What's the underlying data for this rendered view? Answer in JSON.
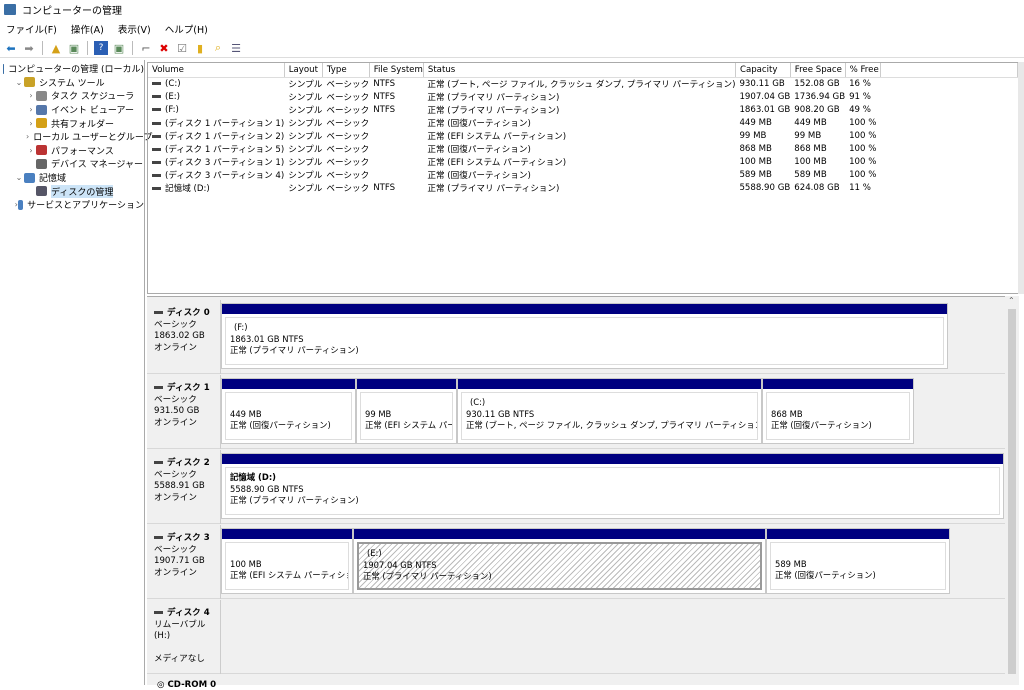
{
  "window": {
    "title": "コンピューターの管理"
  },
  "menu": [
    "ファイル(F)",
    "操作(A)",
    "表示(V)",
    "ヘルプ(H)"
  ],
  "tree": [
    {
      "label": "コンピューターの管理 (ローカル)",
      "level": 0,
      "chev": ""
    },
    {
      "label": "システム ツール",
      "level": 1,
      "chev": "⌄"
    },
    {
      "label": "タスク スケジューラ",
      "level": 2,
      "chev": "›"
    },
    {
      "label": "イベント ビューアー",
      "level": 2,
      "chev": "›"
    },
    {
      "label": "共有フォルダー",
      "level": 2,
      "chev": "›"
    },
    {
      "label": "ローカル ユーザーとグループ",
      "level": 2,
      "chev": "›"
    },
    {
      "label": "パフォーマンス",
      "level": 2,
      "chev": "›"
    },
    {
      "label": "デバイス マネージャー",
      "level": 2,
      "chev": ""
    },
    {
      "label": "記憶域",
      "level": 1,
      "chev": "⌄"
    },
    {
      "label": "ディスクの管理",
      "level": 2,
      "chev": ""
    },
    {
      "label": "サービスとアプリケーション",
      "level": 1,
      "chev": "›"
    }
  ],
  "volumes": {
    "columns": [
      "Volume",
      "Layout",
      "Type",
      "File System",
      "Status",
      "Capacity",
      "Free Space",
      "% Free"
    ],
    "rows": [
      [
        "(C:)",
        "シンプル",
        "ベーシック",
        "NTFS",
        "正常 (ブート, ページ ファイル, クラッシュ ダンプ, プライマリ パーティション)",
        "930.11 GB",
        "152.08 GB",
        "16 %"
      ],
      [
        "(E:)",
        "シンプル",
        "ベーシック",
        "NTFS",
        "正常 (プライマリ パーティション)",
        "1907.04 GB",
        "1736.94 GB",
        "91 %"
      ],
      [
        "(F:)",
        "シンプル",
        "ベーシック",
        "NTFS",
        "正常 (プライマリ パーティション)",
        "1863.01 GB",
        "908.20 GB",
        "49 %"
      ],
      [
        "(ディスク 1 パーティション 1)",
        "シンプル",
        "ベーシック",
        "",
        "正常 (回復パーティション)",
        "449 MB",
        "449 MB",
        "100 %"
      ],
      [
        "(ディスク 1 パーティション 2)",
        "シンプル",
        "ベーシック",
        "",
        "正常 (EFI システム パーティション)",
        "99 MB",
        "99 MB",
        "100 %"
      ],
      [
        "(ディスク 1 パーティション 5)",
        "シンプル",
        "ベーシック",
        "",
        "正常 (回復パーティション)",
        "868 MB",
        "868 MB",
        "100 %"
      ],
      [
        "(ディスク 3 パーティション 1)",
        "シンプル",
        "ベーシック",
        "",
        "正常 (EFI システム パーティション)",
        "100 MB",
        "100 MB",
        "100 %"
      ],
      [
        "(ディスク 3 パーティション 4)",
        "シンプル",
        "ベーシック",
        "",
        "正常 (回復パーティション)",
        "589 MB",
        "589 MB",
        "100 %"
      ],
      [
        "記憶域 (D:)",
        "シンプル",
        "ベーシック",
        "NTFS",
        "正常 (プライマリ パーティション)",
        "5588.90 GB",
        "624.08 GB",
        "11 %"
      ]
    ]
  },
  "disks": [
    {
      "name": "ディスク 0",
      "type": "ベーシック",
      "size": "1863.02 GB",
      "state": "オンライン",
      "parts": [
        {
          "title": "(F:)",
          "size": "1863.01 GB NTFS",
          "status": "正常 (プライマリ パーティション)"
        }
      ]
    },
    {
      "name": "ディスク 1",
      "type": "ベーシック",
      "size": "931.50 GB",
      "state": "オンライン",
      "parts": [
        {
          "title": "",
          "size": "449 MB",
          "status": "正常 (回復パーティション)"
        },
        {
          "title": "",
          "size": "99 MB",
          "status": "正常 (EFI システム パーテ"
        },
        {
          "title": "(C:)",
          "size": "930.11 GB NTFS",
          "status": "正常 (ブート, ページ ファイル, クラッシュ ダンプ, プライマリ パーティション)"
        },
        {
          "title": "",
          "size": "868 MB",
          "status": "正常 (回復パーティション)"
        }
      ]
    },
    {
      "name": "ディスク 2",
      "type": "ベーシック",
      "size": "5588.91 GB",
      "state": "オンライン",
      "parts": [
        {
          "title": "記憶域  (D:)",
          "size": "5588.90 GB NTFS",
          "status": "正常 (プライマリ パーティション)"
        }
      ]
    },
    {
      "name": "ディスク 3",
      "type": "ベーシック",
      "size": "1907.71 GB",
      "state": "オンライン",
      "parts": [
        {
          "title": "",
          "size": "100 MB",
          "status": "正常 (EFI システム パーティション)"
        },
        {
          "title": "(E:)",
          "size": "1907.04 GB NTFS",
          "status": "正常 (プライマリ パーティション)"
        },
        {
          "title": "",
          "size": "589 MB",
          "status": "正常 (回復パーティション)"
        }
      ]
    },
    {
      "name": "ディスク 4",
      "type": "リムーバブル (H:)",
      "size": "",
      "state": "メディアなし",
      "parts": []
    }
  ],
  "cdrom": "CD-ROM 0",
  "colors": {
    "partition_bar": "#000080",
    "selection": "#cce4f7"
  }
}
